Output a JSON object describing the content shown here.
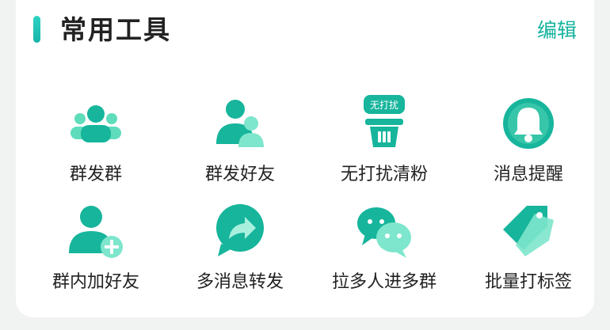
{
  "header": {
    "title": "常用工具",
    "edit_label": "编辑"
  },
  "colors": {
    "primary": "#14b29d",
    "primary_light": "#5fdcbb",
    "primary_dark": "#0f9a86",
    "accent": "#22c9b7",
    "text": "#222222",
    "background": "#f1f3f2"
  },
  "tools": [
    {
      "label": "群发群",
      "icon": "group-broadcast-icon"
    },
    {
      "label": "群发好友",
      "icon": "friends-broadcast-icon"
    },
    {
      "label": "无打扰清粉",
      "icon": "no-disturb-clean-icon",
      "badge": "无打扰"
    },
    {
      "label": "消息提醒",
      "icon": "bell-icon"
    },
    {
      "label": "群内加好友",
      "icon": "add-friend-icon"
    },
    {
      "label": "多消息转发",
      "icon": "forward-icon"
    },
    {
      "label": "拉多人进多群",
      "icon": "wechat-chat-icon"
    },
    {
      "label": "批量打标签",
      "icon": "tag-icon"
    }
  ]
}
